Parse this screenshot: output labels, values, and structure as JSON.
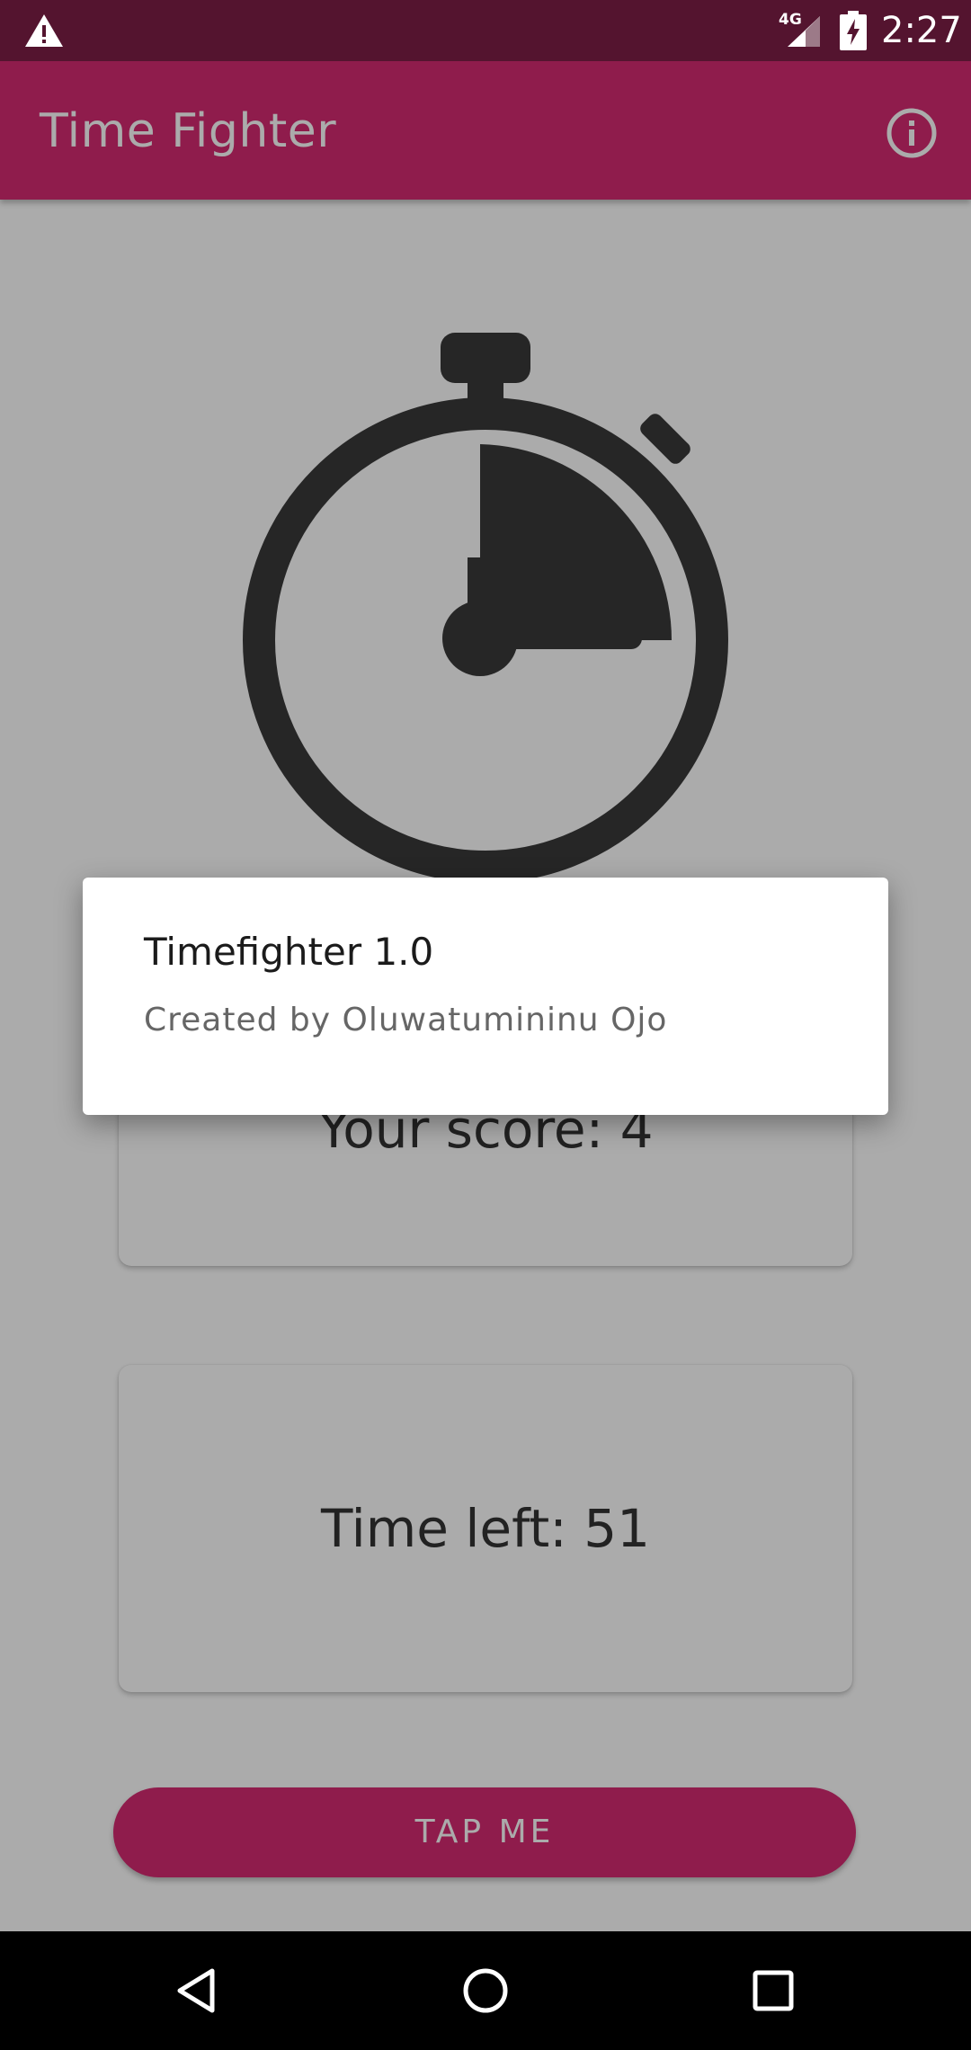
{
  "status_bar": {
    "network_type": "4G",
    "time": "2:27",
    "warning_icon": "warning-icon",
    "signal_icon": "cell-signal-icon",
    "battery_icon": "battery-charging-icon"
  },
  "app_bar": {
    "title": "Time Fighter",
    "info_icon": "info-icon"
  },
  "content": {
    "stopwatch_icon": "stopwatch-icon",
    "score_label": "Your score: 4",
    "time_left_label": "Time left: 51",
    "tap_button_label": "TAP ME"
  },
  "dialog": {
    "title": "Timefighter 1.0",
    "message": "Created by Oluwatumininu Ojo"
  },
  "nav_bar": {
    "back_icon": "back-icon",
    "home_icon": "home-icon",
    "recents_icon": "recents-icon"
  },
  "colors": {
    "status_bar": "#54142f",
    "app_bar": "#d62a72",
    "accent": "#d62a72",
    "dialog_title": "#1b1b1b",
    "dialog_message": "#666666"
  }
}
